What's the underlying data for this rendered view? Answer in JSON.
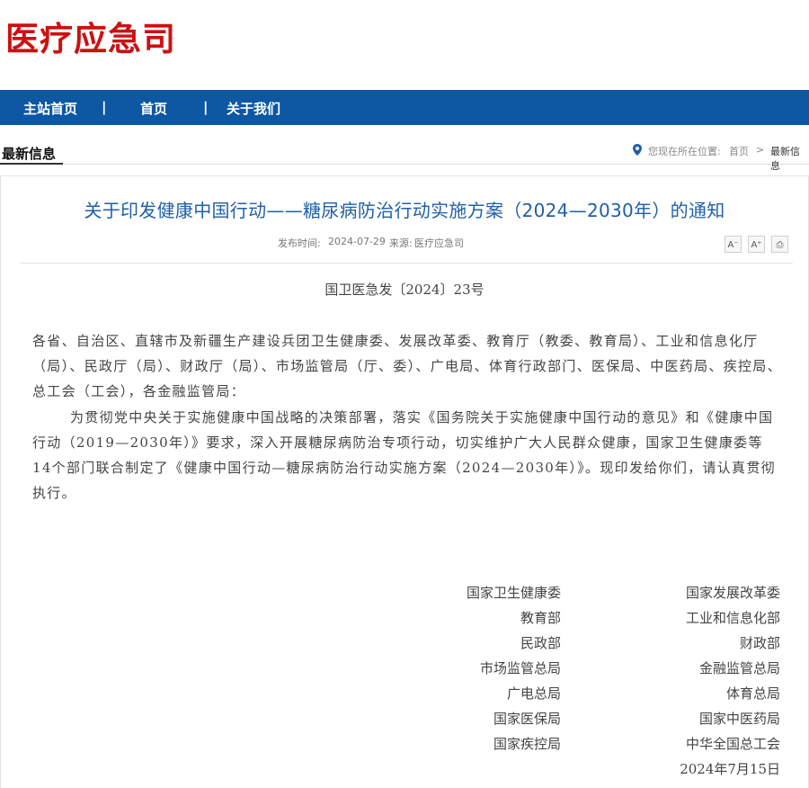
{
  "site": {
    "logo_text": "医疗应急司"
  },
  "nav": {
    "items": [
      "主站首页",
      "首页",
      "关于我们"
    ],
    "separator": "|"
  },
  "section": {
    "title": "最新信息",
    "breadcrumb_prefix": "您现在所在位置:",
    "breadcrumb_home": "首页",
    "breadcrumb_sep": ">",
    "breadcrumb_current": "最新信息"
  },
  "article": {
    "title": "关于印发健康中国行动——糖尿病防治行动实施方案（2024—2030年）的通知",
    "meta": {
      "date_label": "发布时间:",
      "date": "2024-07-29",
      "source_label": "来源:",
      "source": "医疗应急司"
    },
    "tools": {
      "font_decrease": "A⁻",
      "font_increase": "A⁺",
      "print": "⎙"
    },
    "doc_number": "国卫医急发〔2024〕23号",
    "paragraphs": [
      "各省、自治区、直辖市及新疆生产建设兵团卫生健康委、发展改革委、教育厅（教委、教育局）、工业和信息化厅（局）、民政厅（局）、财政厅（局）、市场监管局（厅、委）、广电局、体育行政部门、医保局、中医药局、疾控局、总工会（工会），各金融监管局：",
      "为贯彻党中央关于实施健康中国战略的决策部署，落实《国务院关于实施健康中国行动的意见》和《健康中国行动（2019—2030年）》要求，深入开展糖尿病防治专项行动，切实维护广大人民群众健康，国家卫生健康委等14个部门联合制定了《健康中国行动—糖尿病防治行动实施方案（2024—2030年）》。现印发给你们，请认真贯彻执行。"
    ],
    "signatories_left": [
      "国家卫生健康委",
      "教育部",
      "民政部",
      "市场监管总局",
      "广电总局",
      "国家医保局",
      "国家疾控局"
    ],
    "signatories_right": [
      "国家发展改革委",
      "工业和信息化部",
      "财政部",
      "金融监管总局",
      "体育总局",
      "国家中医药局",
      "中华全国总工会"
    ],
    "sign_date": "2024年7月15日"
  },
  "colors": {
    "brand_red": "#cc1111",
    "nav_blue": "#0d57a3",
    "title_blue": "#1f5fa8"
  }
}
